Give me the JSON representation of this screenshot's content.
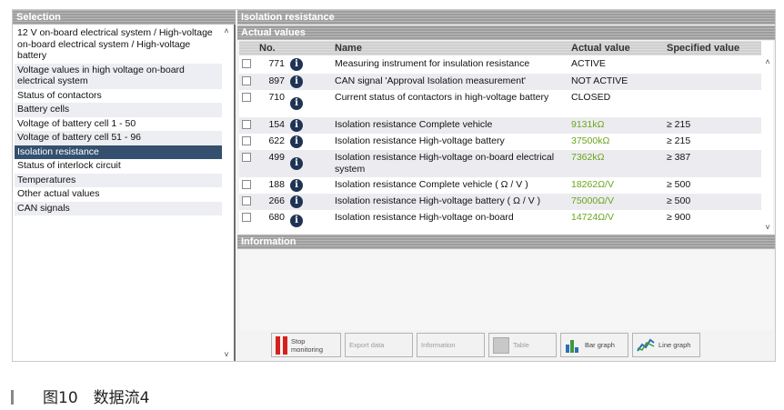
{
  "left_panel": {
    "title": "Selection",
    "items": [
      {
        "label": "12 V on-board electrical system / High-voltage on-board electrical system / High-voltage battery"
      },
      {
        "label": "Voltage values in high voltage on-board electrical system"
      },
      {
        "label": "Status of contactors"
      },
      {
        "label": "Battery cells"
      },
      {
        "label": "Voltage of battery cell 1 - 50"
      },
      {
        "label": "Voltage of battery cell 51 - 96"
      },
      {
        "label": "Isolation resistance"
      },
      {
        "label": "Status of interlock circuit"
      },
      {
        "label": "Temperatures"
      },
      {
        "label": "Other actual values"
      },
      {
        "label": "CAN signals"
      }
    ],
    "selected": "Isolation resistance"
  },
  "right_panel": {
    "title": "Isolation resistance",
    "section_actual": "Actual values",
    "section_info": "Information",
    "columns": {
      "no": "No.",
      "name": "Name",
      "actual": "Actual value",
      "spec": "Specified value"
    },
    "rows": [
      {
        "no": "771",
        "name": "Measuring instrument for insulation resistance",
        "actual": "ACTIVE",
        "spec": "",
        "green": false
      },
      {
        "no": "897",
        "name": "CAN signal 'Approval Isolation measurement'",
        "actual": "NOT ACTIVE",
        "spec": "",
        "green": false
      },
      {
        "no": "710",
        "name": "Current status of contactors in high-voltage battery",
        "actual": "CLOSED",
        "spec": "",
        "green": false
      },
      {
        "no": "154",
        "name": "Isolation resistance Complete vehicle",
        "actual": "9131kΩ",
        "spec": "≥ 215",
        "green": true
      },
      {
        "no": "622",
        "name": "Isolation resistance High-voltage battery",
        "actual": "37500kΩ",
        "spec": "≥ 215",
        "green": true
      },
      {
        "no": "499",
        "name": "Isolation resistance High-voltage on-board electrical system",
        "actual": "7362kΩ",
        "spec": "≥ 387",
        "green": true
      },
      {
        "no": "188",
        "name": "Isolation resistance Complete vehicle ( Ω / V )",
        "actual": "18262Ω/V",
        "spec": "≥ 500",
        "green": true
      },
      {
        "no": "266",
        "name": "Isolation resistance High-voltage battery ( Ω / V )",
        "actual": "75000Ω/V",
        "spec": "≥ 500",
        "green": true
      },
      {
        "no": "680",
        "name": "Isolation resistance High-voltage on-board",
        "actual": "14724Ω/V",
        "spec": "≥ 900",
        "green": true
      }
    ],
    "info_icon": "i"
  },
  "toolbar": {
    "stop": "Stop monitoring",
    "export": "Export data",
    "information": "Information",
    "table": "Table",
    "bar_graph": "Bar graph",
    "line_graph": "Line graph"
  },
  "icons": {
    "scroll_up": "^",
    "scroll_down": "v"
  },
  "colors": {
    "selected_bg": "#34506e",
    "value_green": "#6aa51c",
    "stop_red": "#d6201c",
    "info_blue": "#1f3354"
  },
  "caption": "图10　数据流4"
}
